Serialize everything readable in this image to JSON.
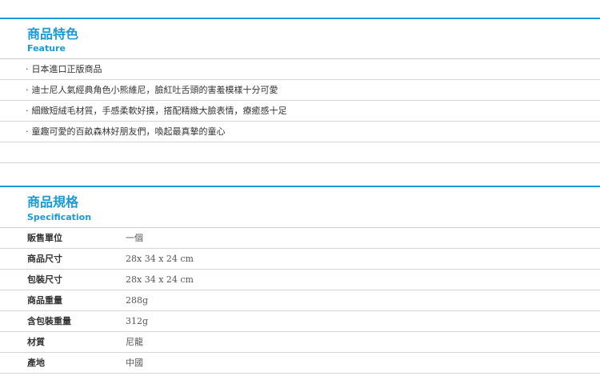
{
  "feature": {
    "title": "商品特色",
    "subtitle": "Feature",
    "bullet": "‧",
    "items": [
      "日本進口正版商品",
      "迪士尼人氣經典角色小熊維尼，臉紅吐舌頭的害羞模樣十分可愛",
      "細緻短絨毛材質，手感柔軟好摸，搭配精緻大臉表情，療癒感十足",
      "童趣可愛的百畝森林好朋友們，喚起最真摯的童心"
    ]
  },
  "specification": {
    "title": "商品規格",
    "subtitle": "Specification",
    "rows": [
      {
        "label": "販售單位",
        "value": "一個"
      },
      {
        "label": "商品尺寸",
        "value": "28x 34 x 24 cm"
      },
      {
        "label": "包裝尺寸",
        "value": "28x 34 x 24 cm"
      },
      {
        "label": "商品重量",
        "value": "288g"
      },
      {
        "label": "含包裝重量",
        "value": "312g"
      },
      {
        "label": "材質",
        "value": "尼龍"
      },
      {
        "label": "產地",
        "value": "中國"
      }
    ]
  },
  "colors": {
    "accent": "#1a9ad6",
    "divider": "#d4d4d4",
    "text": "#333333"
  }
}
